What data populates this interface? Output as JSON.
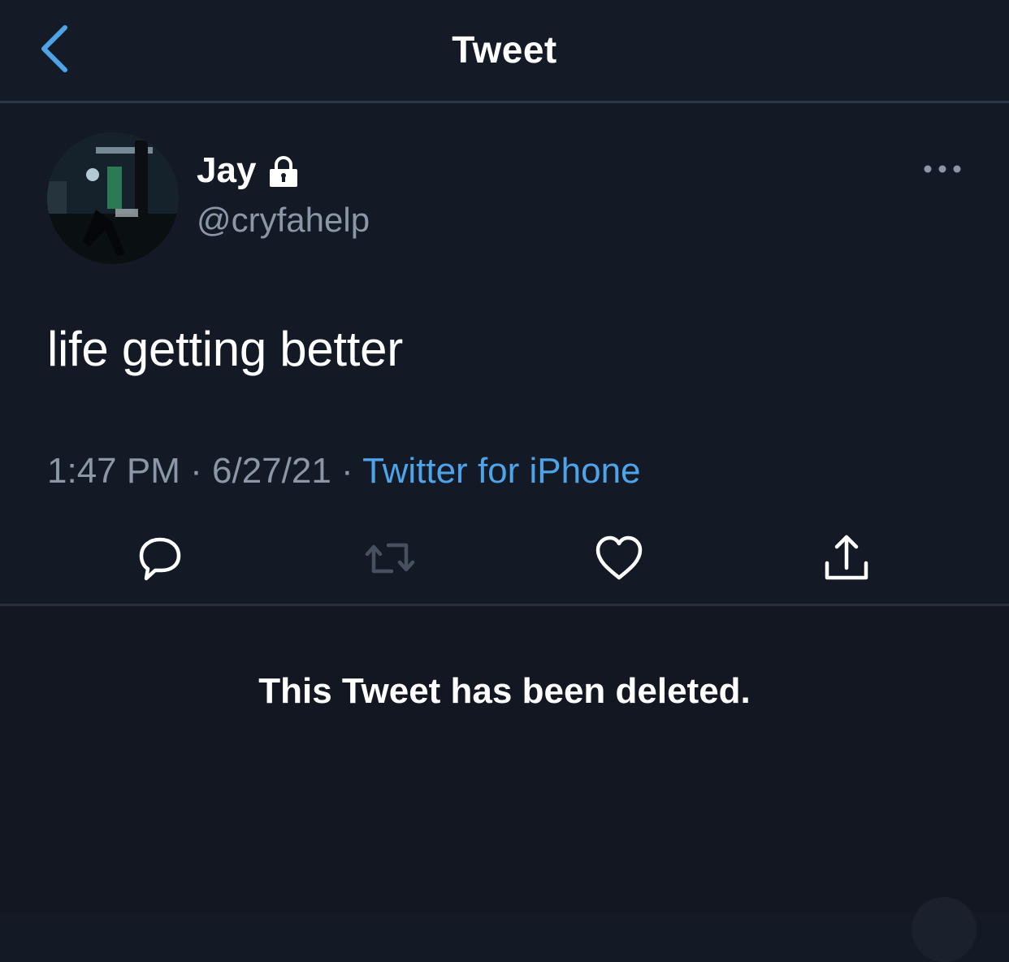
{
  "header": {
    "title": "Tweet",
    "back_icon": "chevron-left-icon"
  },
  "tweet": {
    "author": {
      "display_name": "Jay",
      "handle": "@cryfahelp",
      "protected_icon": "lock-icon"
    },
    "text": "life getting better",
    "time": "1:47 PM",
    "date": "6/27/21",
    "separator": "·",
    "source": "Twitter for iPhone",
    "actions": [
      "reply-icon",
      "retweet-icon",
      "like-icon",
      "share-icon"
    ]
  },
  "deleted_notice": "This Tweet has been deleted.",
  "colors": {
    "background": "#131a25",
    "accent": "#4ea4e9",
    "secondary_text": "#8b97a6",
    "primary_text": "#ffffff"
  }
}
